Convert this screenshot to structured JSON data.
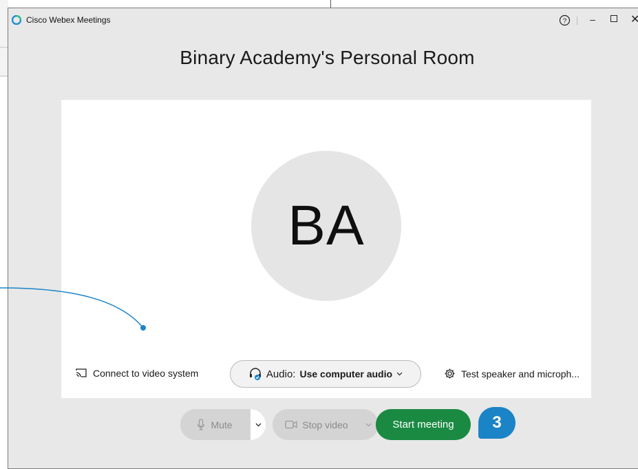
{
  "window": {
    "app_title": "Cisco Webex Meetings",
    "minimize_glyph": "–",
    "close_glyph": "✕"
  },
  "room": {
    "title": "Binary Academy's Personal Room",
    "avatar_initials": "BA"
  },
  "options": {
    "connect_label": "Connect to video system",
    "audio_prefix": "Audio:",
    "audio_value": "Use computer audio",
    "test_label": "Test speaker and microph..."
  },
  "controls": {
    "mute_label": "Mute",
    "stop_video_label": "Stop video",
    "start_meeting_label": "Start meeting"
  },
  "annotation": {
    "step_number": "3"
  },
  "colors": {
    "start_button": "#1a8a43",
    "callout_blue": "#1b84c6",
    "window_bg": "#e8e8e8"
  },
  "icons": [
    "webex-logo-icon",
    "help-icon",
    "cast-icon",
    "headset-icon",
    "gear-icon",
    "mic-icon",
    "video-camera-icon",
    "chevron-down-icon"
  ]
}
